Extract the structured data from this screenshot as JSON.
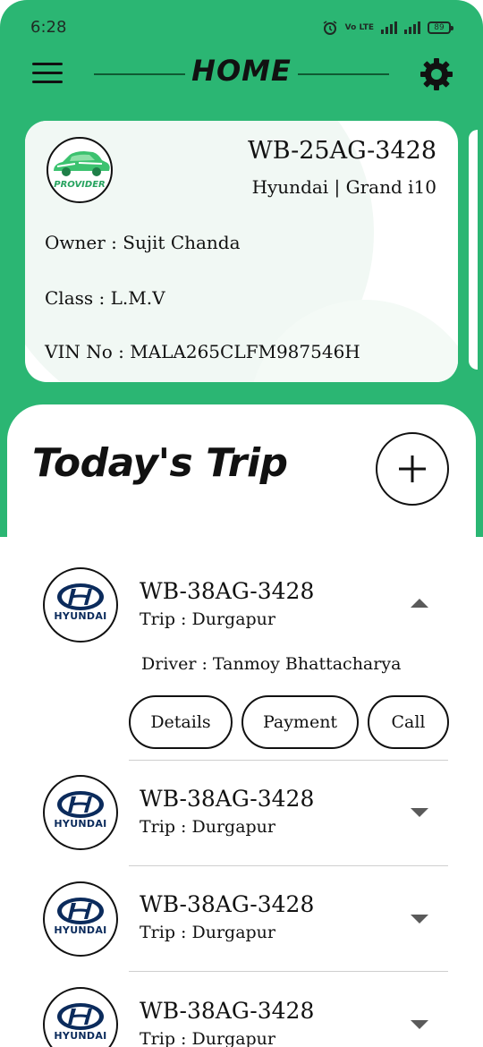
{
  "status_bar": {
    "time": "6:28",
    "volte": "Vo LTE",
    "battery": "89"
  },
  "header": {
    "title": "HOME"
  },
  "vehicle": {
    "provider_label": "PROVIDER",
    "plate": "WB-25AG-3428",
    "make_model": "Hyundai | Grand i10",
    "owner": "Owner : Sujit Chanda",
    "class": "Class : L.M.V",
    "vin": "VIN No : MALA265CLFM987546H"
  },
  "today": {
    "title": "Today's Trip",
    "trips": [
      {
        "brand": "HYUNDAI",
        "plate": "WB-38AG-3428",
        "destination": "Trip : Durgapur",
        "driver": "Driver : Tanmoy Bhattacharya",
        "expanded": true
      },
      {
        "brand": "HYUNDAI",
        "plate": "WB-38AG-3428",
        "destination": "Trip : Durgapur",
        "expanded": false
      },
      {
        "brand": "HYUNDAI",
        "plate": "WB-38AG-3428",
        "destination": "Trip : Durgapur",
        "expanded": false
      },
      {
        "brand": "HYUNDAI",
        "plate": "WB-38AG-3428",
        "destination": "Trip : Durgapur",
        "expanded": false
      }
    ],
    "actions": {
      "details": "Details",
      "payment": "Payment",
      "call": "Call"
    }
  },
  "colors": {
    "header_green": "#2bb673",
    "logo_blue": "#0b2b5c",
    "provider_green": "#27a35f"
  }
}
